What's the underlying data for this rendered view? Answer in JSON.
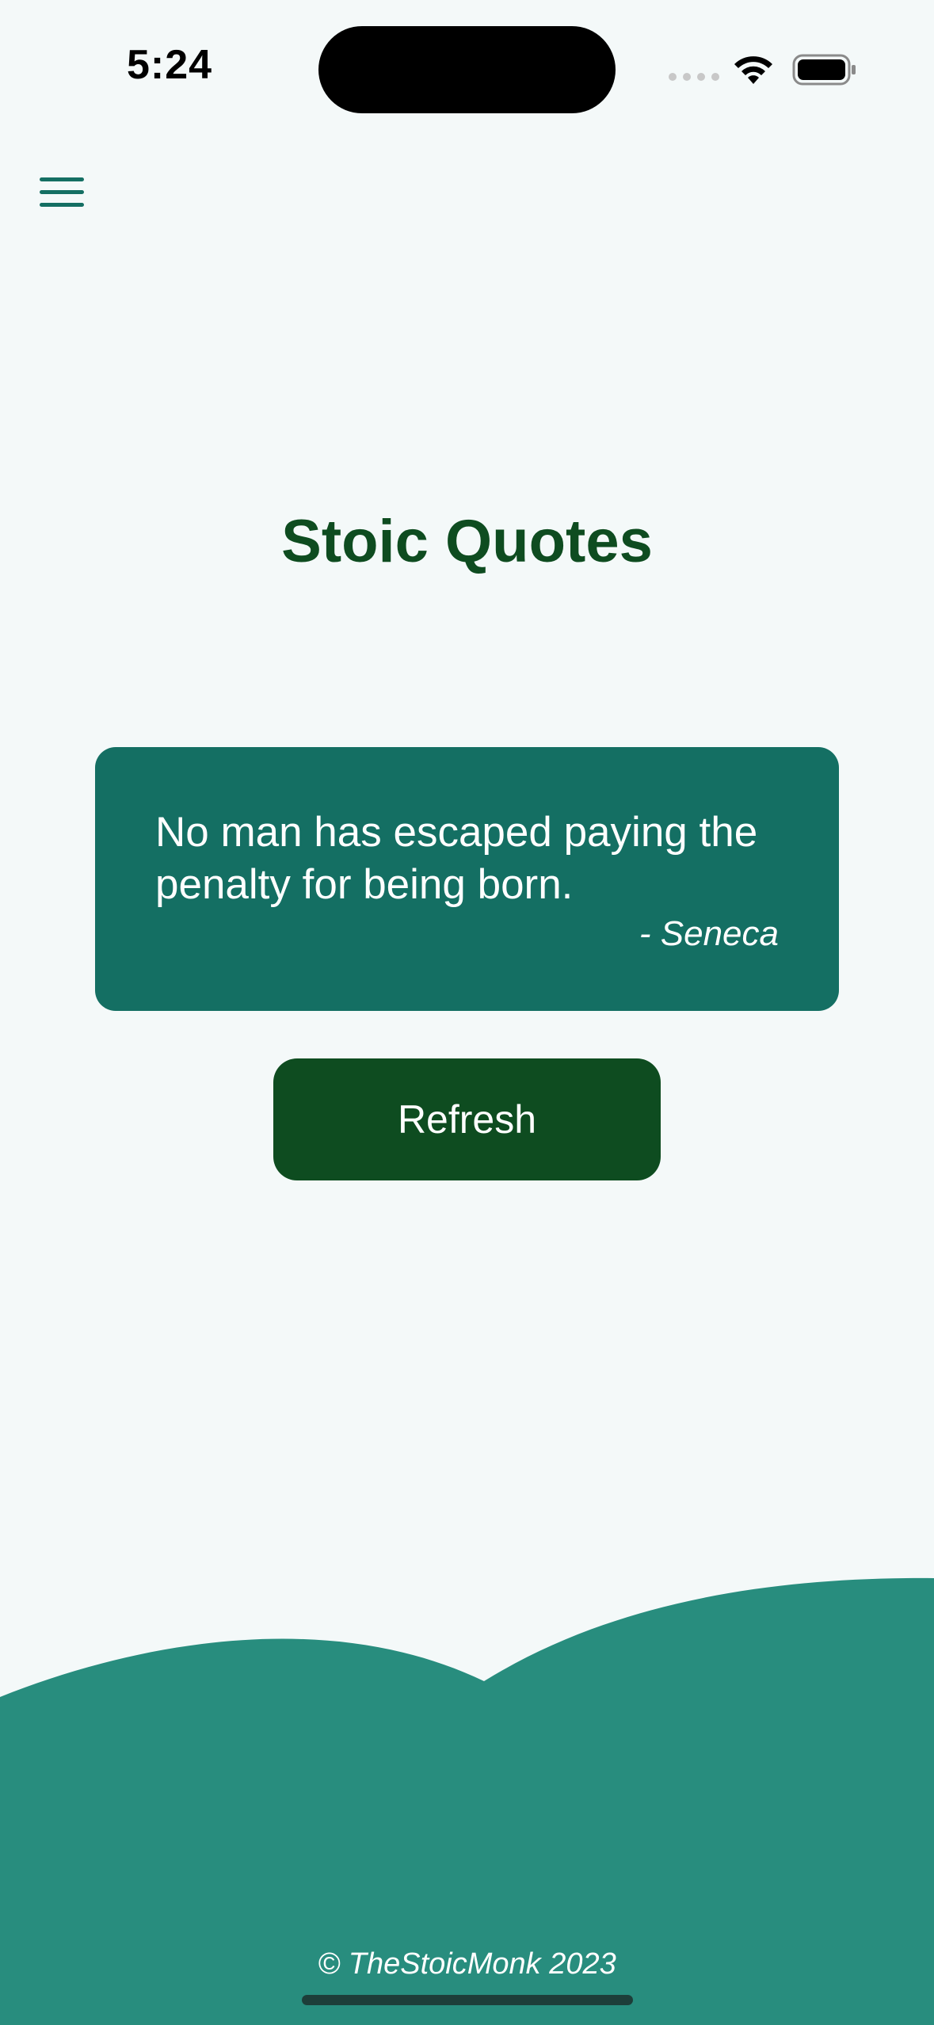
{
  "status_bar": {
    "time": "5:24",
    "icons": [
      "cellular-signal-icon",
      "wifi-icon",
      "battery-icon"
    ]
  },
  "header": {
    "menu_icon": "hamburger-menu-icon"
  },
  "main": {
    "title": "Stoic Quotes",
    "quote": {
      "text": "No man has escaped paying the penalty for being born.",
      "author": "- Seneca"
    },
    "refresh_label": "Refresh"
  },
  "footer": {
    "text": "© TheStoicMonk 2023"
  },
  "colors": {
    "background": "#f4f9f9",
    "title": "#0e4c20",
    "card": "#146f63",
    "button": "#0e4c20",
    "wave": "#288d7e",
    "menu_icon": "#146f63"
  }
}
